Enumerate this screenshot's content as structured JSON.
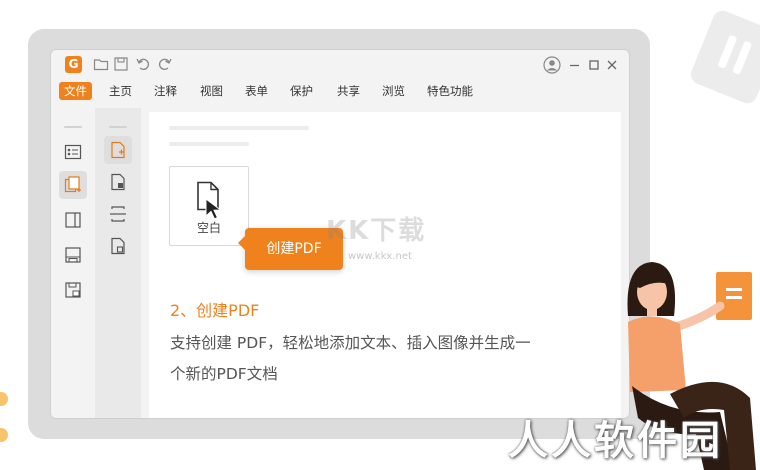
{
  "window": {
    "logo_letter": "G",
    "menu": [
      "文件",
      "主页",
      "注释",
      "视图",
      "表单",
      "保护",
      "共享",
      "浏览",
      "特色功能"
    ],
    "active_menu": "文件"
  },
  "content": {
    "blank_label": "空白",
    "tooltip": "创建PDF"
  },
  "watermark": {
    "text": "KK下载",
    "url": "www.kkx.net"
  },
  "step": {
    "title": "2、创建PDF",
    "desc_line1": "支持创建 PDF，轻松地添加文本、插入图像并生成一",
    "desc_line2": "个新的PDF文档"
  },
  "brand": "人人软件园",
  "colors": {
    "accent": "#f0821e",
    "frame": "#dcdcdc",
    "skin": "#f7c4a8"
  }
}
